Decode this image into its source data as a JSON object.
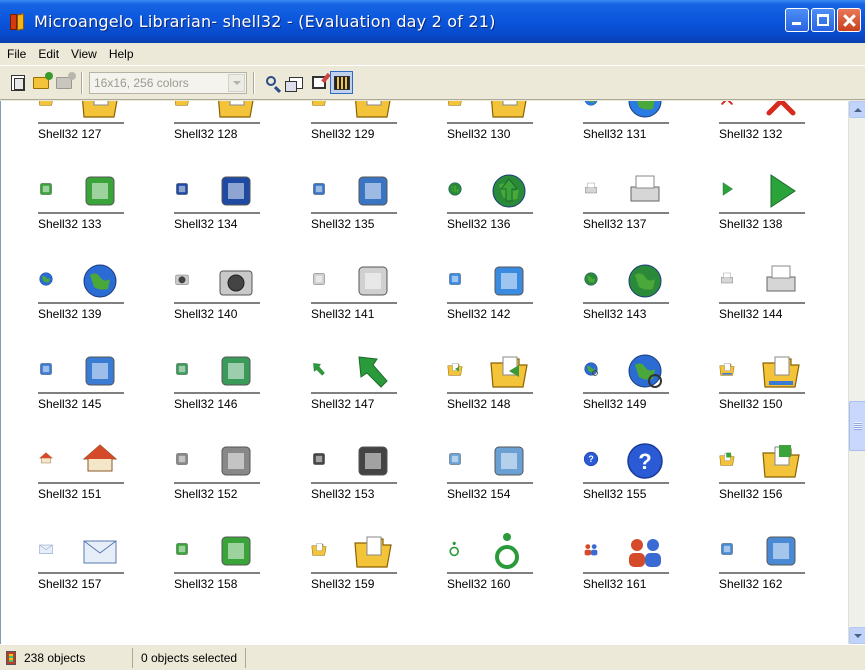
{
  "window": {
    "title": "Microangelo Librarian- shell32 -  (Evaluation day 2 of 21)"
  },
  "menu": [
    "File",
    "Edit",
    "View",
    "Help"
  ],
  "toolbar": {
    "format_combo": "16x16, 256 colors"
  },
  "icons": [
    {
      "label": "Shell32 127",
      "kind": "folder-doc",
      "color": "#f3c43a"
    },
    {
      "label": "Shell32 128",
      "kind": "folder-doc",
      "color": "#f3c43a"
    },
    {
      "label": "Shell32 129",
      "kind": "folder-doc",
      "color": "#f3c43a"
    },
    {
      "label": "Shell32 130",
      "kind": "folder-doc",
      "color": "#f3c43a"
    },
    {
      "label": "Shell32 131",
      "kind": "globe-windows",
      "color": "#2a7be4"
    },
    {
      "label": "Shell32 132",
      "kind": "red-x",
      "color": "#d62a1f"
    },
    {
      "label": "Shell32 133",
      "kind": "doc-arrow",
      "color": "#3aa33a"
    },
    {
      "label": "Shell32 134",
      "kind": "text-cursor",
      "color": "#1f4aa3"
    },
    {
      "label": "Shell32 135",
      "kind": "documents",
      "color": "#3a75c4"
    },
    {
      "label": "Shell32 136",
      "kind": "globe-up",
      "color": "#2a8a3a"
    },
    {
      "label": "Shell32 137",
      "kind": "printer",
      "color": "#8a8a8a"
    },
    {
      "label": "Shell32 138",
      "kind": "play",
      "color": "#2aa33a"
    },
    {
      "label": "Shell32 139",
      "kind": "globe",
      "color": "#2a6bd4"
    },
    {
      "label": "Shell32 140",
      "kind": "camera",
      "color": "#7a7a7a"
    },
    {
      "label": "Shell32 141",
      "kind": "projector-screen",
      "color": "#d0d0d0"
    },
    {
      "label": "Shell32 142",
      "kind": "pc-pen",
      "color": "#3a8ae0"
    },
    {
      "label": "Shell32 143",
      "kind": "globe-frame",
      "color": "#2a8a3a"
    },
    {
      "label": "Shell32 144",
      "kind": "scanner",
      "color": "#5a9ad4"
    },
    {
      "label": "Shell32 145",
      "kind": "checklist",
      "color": "#3a7bd4"
    },
    {
      "label": "Shell32 146",
      "kind": "recycle",
      "color": "#3a9a5a"
    },
    {
      "label": "Shell32 147",
      "kind": "green-arrow",
      "color": "#2a9a3a"
    },
    {
      "label": "Shell32 148",
      "kind": "folder-arrows",
      "color": "#f3c43a"
    },
    {
      "label": "Shell32 149",
      "kind": "globe-search",
      "color": "#2a6bd4"
    },
    {
      "label": "Shell32 150",
      "kind": "folder-network",
      "color": "#f3c43a"
    },
    {
      "label": "Shell32 151",
      "kind": "house-net",
      "color": "#d44a2a"
    },
    {
      "label": "Shell32 152",
      "kind": "clock-disc",
      "color": "#888888"
    },
    {
      "label": "Shell32 153",
      "kind": "disc-arm",
      "color": "#444444"
    },
    {
      "label": "Shell32 154",
      "kind": "clock-bin",
      "color": "#6aa0d4"
    },
    {
      "label": "Shell32 155",
      "kind": "help",
      "color": "#2a5ad4"
    },
    {
      "label": "Shell32 156",
      "kind": "folder-puzzle",
      "color": "#f3c43a"
    },
    {
      "label": "Shell32 157",
      "kind": "mail",
      "color": "#6a9ad4"
    },
    {
      "label": "Shell32 158",
      "kind": "clock-green",
      "color": "#3aa33a"
    },
    {
      "label": "Shell32 159",
      "kind": "folder-open",
      "color": "#f3c43a"
    },
    {
      "label": "Shell32 160",
      "kind": "wheelchair",
      "color": "#2a9a3a"
    },
    {
      "label": "Shell32 161",
      "kind": "users",
      "color": "#3a6ad4"
    },
    {
      "label": "Shell32 162",
      "kind": "monitor-palette",
      "color": "#4a8ad4"
    }
  ],
  "status": {
    "objects": "238 objects",
    "selected": "0 objects selected"
  }
}
